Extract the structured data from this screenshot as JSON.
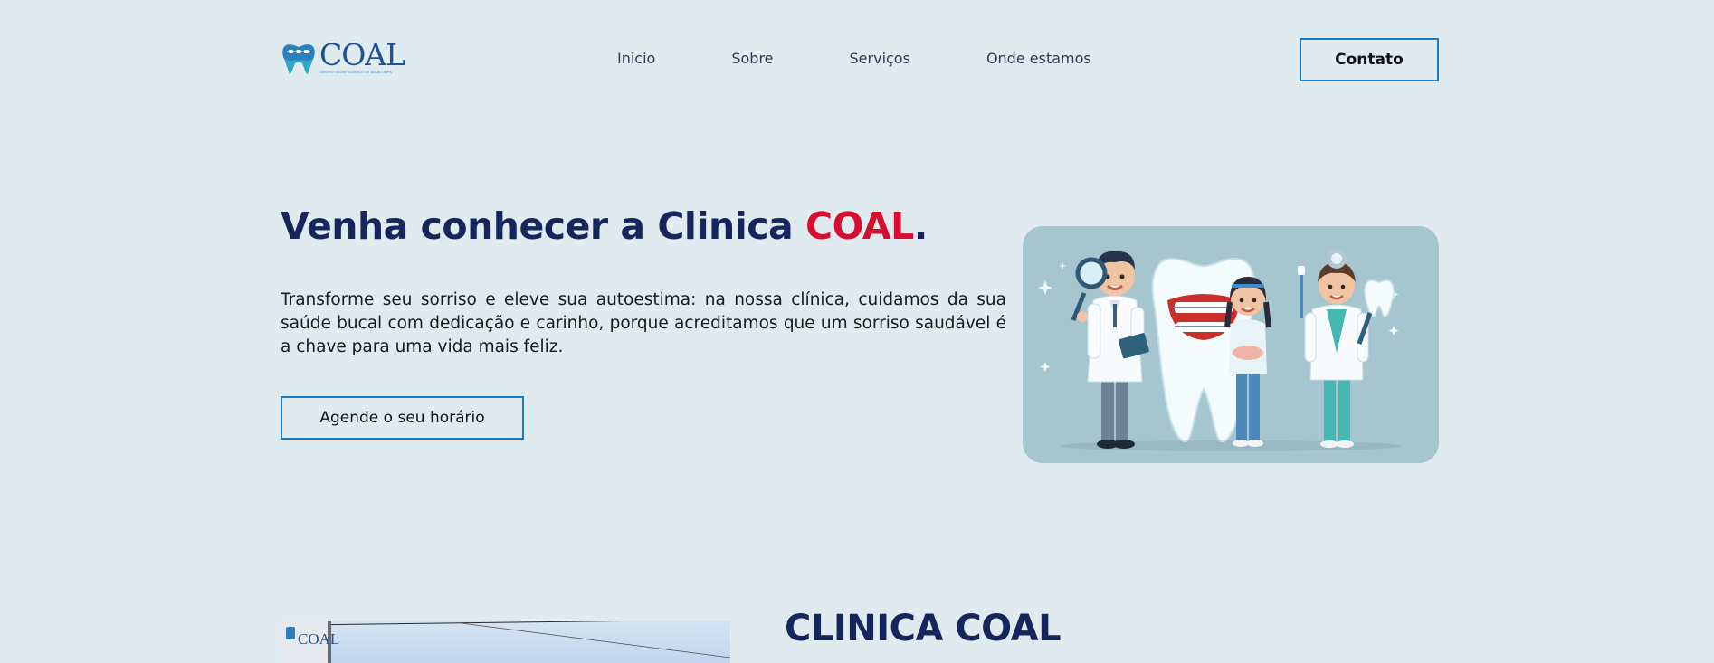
{
  "header": {
    "logo": {
      "word": "COAL",
      "tagline": "CENTRO ODONTOLÓGICO DE ÁGUA LIMPA",
      "icon": "tooth-icon"
    },
    "nav": [
      {
        "label": "Inicio"
      },
      {
        "label": "Sobre"
      },
      {
        "label": "Serviços"
      },
      {
        "label": "Onde estamos"
      }
    ],
    "contact_label": "Contato"
  },
  "hero": {
    "title_prefix": "Venha conhecer a Clinica ",
    "title_accent": "COAL",
    "title_suffix": ".",
    "description": "Transforme seu sorriso e eleve sua autoestima: na nossa clínica, cuidamos da sua saúde bucal com dedicação e carinho, porque acreditamos que um sorriso saudável é a chave para uma vida mais feliz.",
    "cta_label": "Agende o seu horário",
    "image_icon": "dental-team-illustration"
  },
  "about": {
    "title": "CLINICA COAL",
    "photo_sign_word": "COAL"
  },
  "colors": {
    "background": "#dfebef",
    "navy": "#16265c",
    "accent_red": "#d70d31",
    "button_border": "#1b7bc1",
    "illustration_bg": "#a6c6cf"
  }
}
